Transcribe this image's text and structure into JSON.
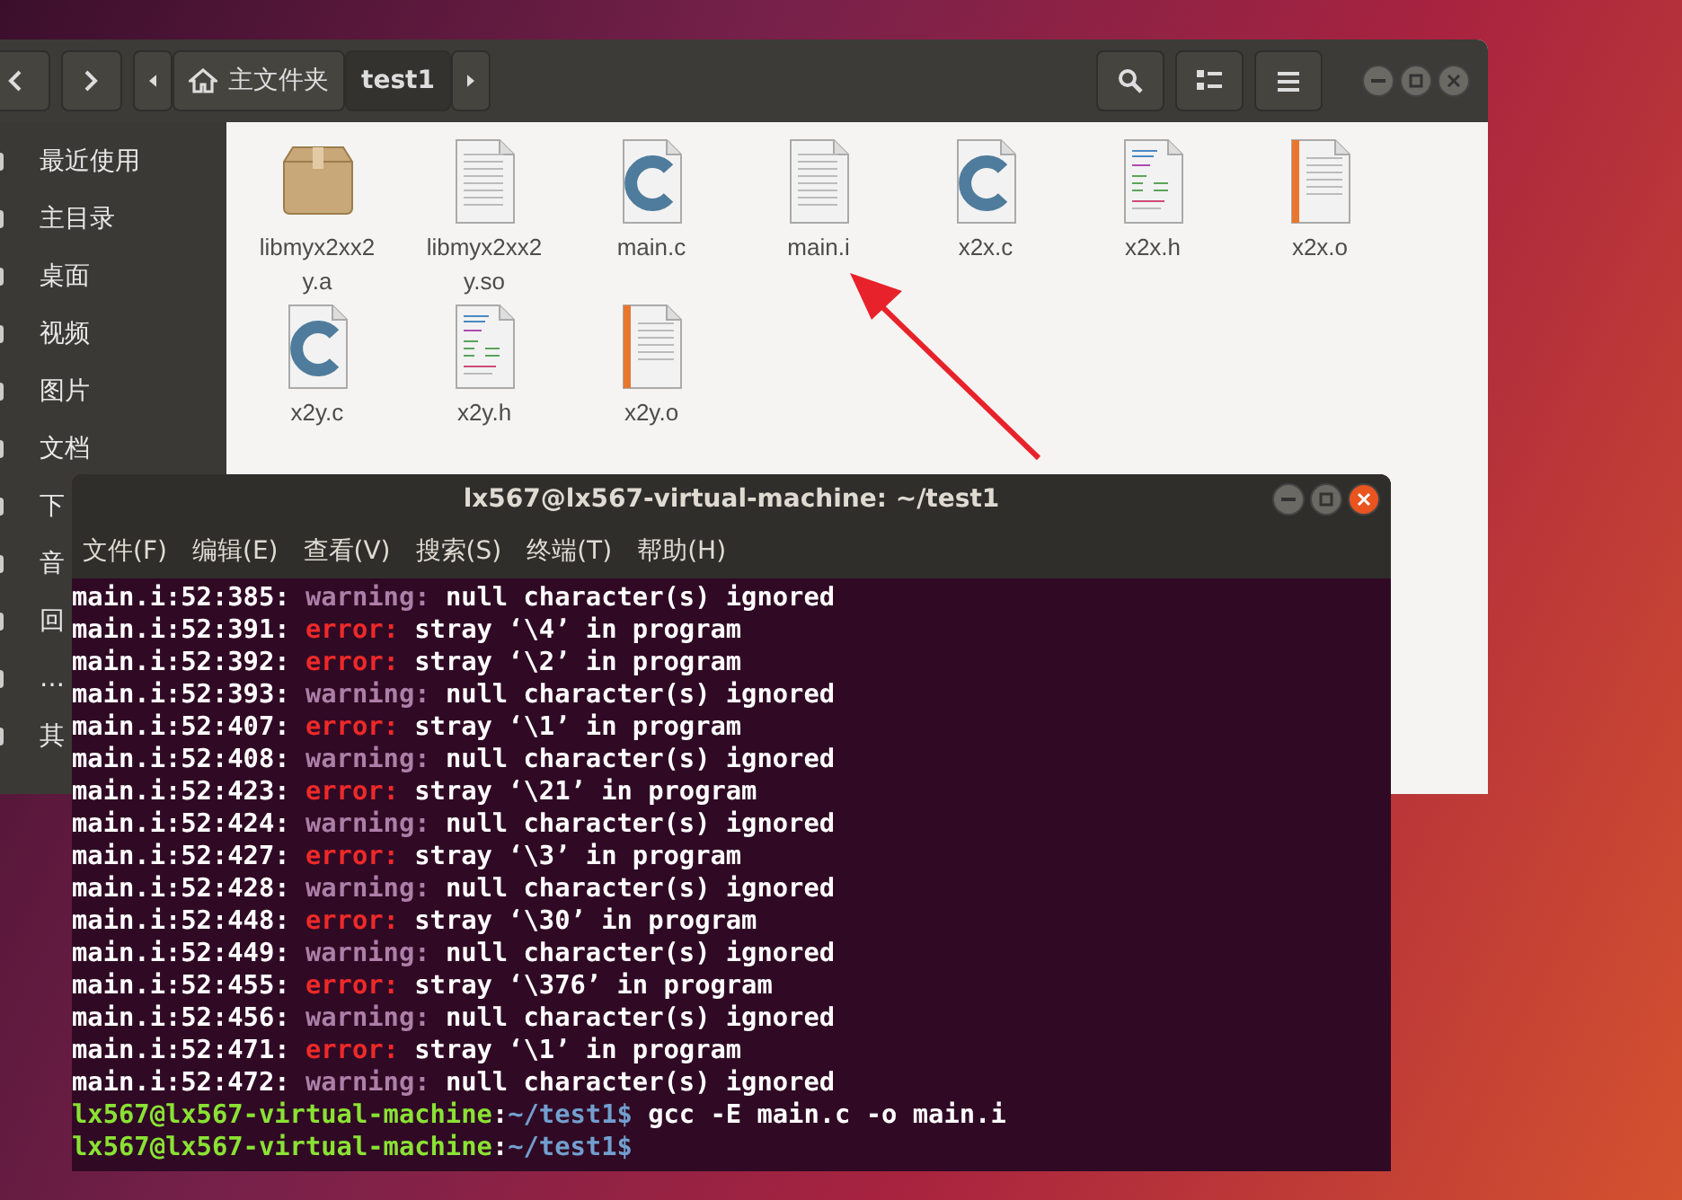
{
  "file_manager": {
    "breadcrumbs": [
      {
        "label": "主文件夹",
        "kind": "home",
        "selected": false
      },
      {
        "label": "test1",
        "kind": "folder",
        "selected": true
      }
    ],
    "sidebar": {
      "items": [
        {
          "label": "最近使用"
        },
        {
          "label": "主目录"
        },
        {
          "label": "桌面"
        },
        {
          "label": "视频"
        },
        {
          "label": "图片"
        },
        {
          "label": "文档"
        },
        {
          "label": "下"
        },
        {
          "label": "音"
        },
        {
          "label": "回"
        },
        {
          "label": "…"
        },
        {
          "label": "其"
        }
      ]
    },
    "files": [
      {
        "name": "libmyx2xx2y.a",
        "kind": "archive"
      },
      {
        "name": "libmyx2xx2y.so",
        "kind": "text"
      },
      {
        "name": "main.c",
        "kind": "c-source"
      },
      {
        "name": "main.i",
        "kind": "text"
      },
      {
        "name": "x2x.c",
        "kind": "c-source"
      },
      {
        "name": "x2x.h",
        "kind": "header"
      },
      {
        "name": "x2x.o",
        "kind": "object"
      },
      {
        "name": "x2y.c",
        "kind": "c-source"
      },
      {
        "name": "x2y.h",
        "kind": "header"
      },
      {
        "name": "x2y.o",
        "kind": "object"
      }
    ]
  },
  "terminal": {
    "title": "lx567@lx567-virtual-machine: ~/test1",
    "menu": [
      "文件(F)",
      "编辑(E)",
      "查看(V)",
      "搜索(S)",
      "终端(T)",
      "帮助(H)"
    ],
    "lines": [
      {
        "kind": "warning",
        "location": "main.i:52:385:",
        "severity": "warning:",
        "message": "null character(s) ignored"
      },
      {
        "kind": "error",
        "location": "main.i:52:391:",
        "severity": "error:",
        "message": "stray ‘\\4’ in program"
      },
      {
        "kind": "error",
        "location": "main.i:52:392:",
        "severity": "error:",
        "message": "stray ‘\\2’ in program"
      },
      {
        "kind": "warning",
        "location": "main.i:52:393:",
        "severity": "warning:",
        "message": "null character(s) ignored"
      },
      {
        "kind": "error",
        "location": "main.i:52:407:",
        "severity": "error:",
        "message": "stray ‘\\1’ in program"
      },
      {
        "kind": "warning",
        "location": "main.i:52:408:",
        "severity": "warning:",
        "message": "null character(s) ignored"
      },
      {
        "kind": "error",
        "location": "main.i:52:423:",
        "severity": "error:",
        "message": "stray ‘\\21’ in program"
      },
      {
        "kind": "warning",
        "location": "main.i:52:424:",
        "severity": "warning:",
        "message": "null character(s) ignored"
      },
      {
        "kind": "error",
        "location": "main.i:52:427:",
        "severity": "error:",
        "message": "stray ‘\\3’ in program"
      },
      {
        "kind": "warning",
        "location": "main.i:52:428:",
        "severity": "warning:",
        "message": "null character(s) ignored"
      },
      {
        "kind": "error",
        "location": "main.i:52:448:",
        "severity": "error:",
        "message": "stray ‘\\30’ in program"
      },
      {
        "kind": "warning",
        "location": "main.i:52:449:",
        "severity": "warning:",
        "message": "null character(s) ignored"
      },
      {
        "kind": "error",
        "location": "main.i:52:455:",
        "severity": "error:",
        "message": "stray ‘\\376’ in program"
      },
      {
        "kind": "warning",
        "location": "main.i:52:456:",
        "severity": "warning:",
        "message": "null character(s) ignored"
      },
      {
        "kind": "error",
        "location": "main.i:52:471:",
        "severity": "error:",
        "message": "stray ‘\\1’ in program"
      },
      {
        "kind": "warning",
        "location": "main.i:52:472:",
        "severity": "warning:",
        "message": "null character(s) ignored"
      },
      {
        "kind": "prompt",
        "user_host": "lx567@lx567-virtual-machine",
        "separator": ":",
        "path": "~/test1",
        "symbol": "$",
        "command": " gcc -E main.c -o main.i"
      },
      {
        "kind": "prompt",
        "user_host": "lx567@lx567-virtual-machine",
        "separator": ":",
        "path": "~/test1",
        "symbol": "$"
      }
    ]
  }
}
